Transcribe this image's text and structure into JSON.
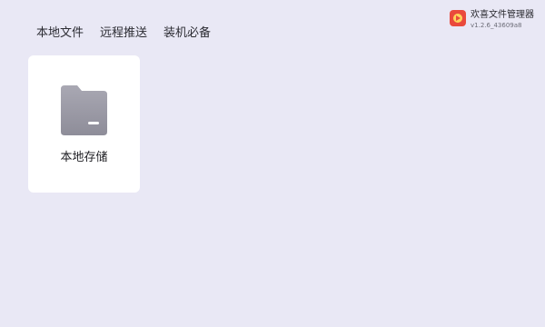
{
  "tabs": [
    {
      "label": "本地文件"
    },
    {
      "label": "远程推送"
    },
    {
      "label": "装机必备"
    }
  ],
  "brand": {
    "name": "欢喜文件管理器",
    "version": "v1.2.6_43609a8"
  },
  "storage_card": {
    "label": "本地存储",
    "icon": "folder-icon"
  },
  "colors": {
    "background": "#e9e8f5",
    "card": "#ffffff",
    "folder": "#9c9ba6",
    "brand_accent": "#ea4a3c"
  }
}
